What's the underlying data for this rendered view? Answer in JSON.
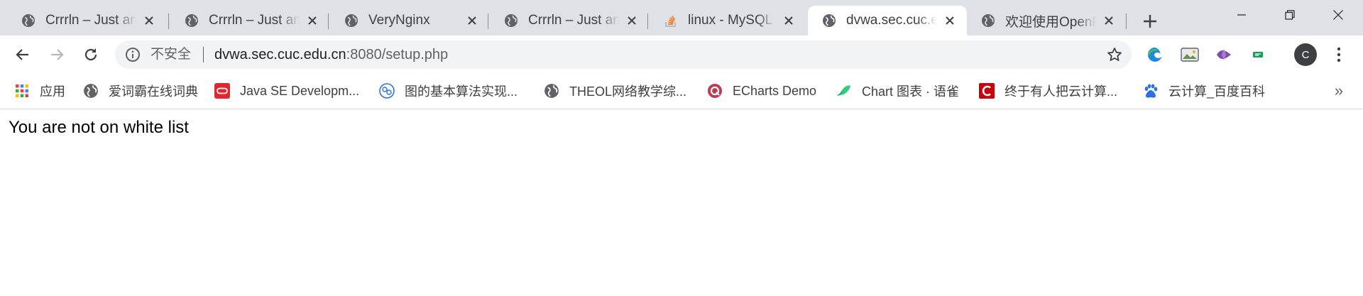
{
  "tabs": [
    {
      "title": "Crrrln – Just an",
      "favicon": "globe-icon"
    },
    {
      "title": "Crrrln – Just an",
      "favicon": "globe-icon"
    },
    {
      "title": "VeryNginx",
      "favicon": "globe-icon"
    },
    {
      "title": "Crrrln – Just an",
      "favicon": "globe-icon"
    },
    {
      "title": "linux - MySQL i",
      "favicon": "stackoverflow-icon"
    },
    {
      "title": "dvwa.sec.cuc.e",
      "favicon": "globe-icon",
      "active": true
    },
    {
      "title": "欢迎使用OpenF",
      "favicon": "globe-icon"
    }
  ],
  "omnibox": {
    "security_label": "不安全",
    "url_host": "dvwa.sec.cuc.edu.cn",
    "url_rest": ":8080/setup.php"
  },
  "profile": {
    "initial": "C"
  },
  "bookmarks": [
    {
      "label": "应用",
      "icon": "apps-grid-icon"
    },
    {
      "label": "爱词霸在线词典",
      "icon": "globe-icon"
    },
    {
      "label": "Java SE Developm...",
      "icon": "oracle-icon"
    },
    {
      "label": "图的基本算法实现...",
      "icon": "blog-icon"
    },
    {
      "label": "THEOL网络教学综...",
      "icon": "globe-icon"
    },
    {
      "label": "ECharts Demo",
      "icon": "echarts-icon"
    },
    {
      "label": "Chart 图表 · 语雀",
      "icon": "yuque-icon"
    },
    {
      "label": "终于有人把云计算...",
      "icon": "csdn-icon"
    },
    {
      "label": "云计算_百度百科",
      "icon": "baidu-icon"
    }
  ],
  "bookmarks_overflow": "»",
  "page": {
    "message": "You are not on white list"
  },
  "colors": {
    "tabstrip_bg": "#dee1e6",
    "omnibox_bg": "#f1f3f4",
    "csdn_red": "#c7000b",
    "oracle_red": "#e0262f",
    "baidu_blue": "#2f6fe4"
  }
}
